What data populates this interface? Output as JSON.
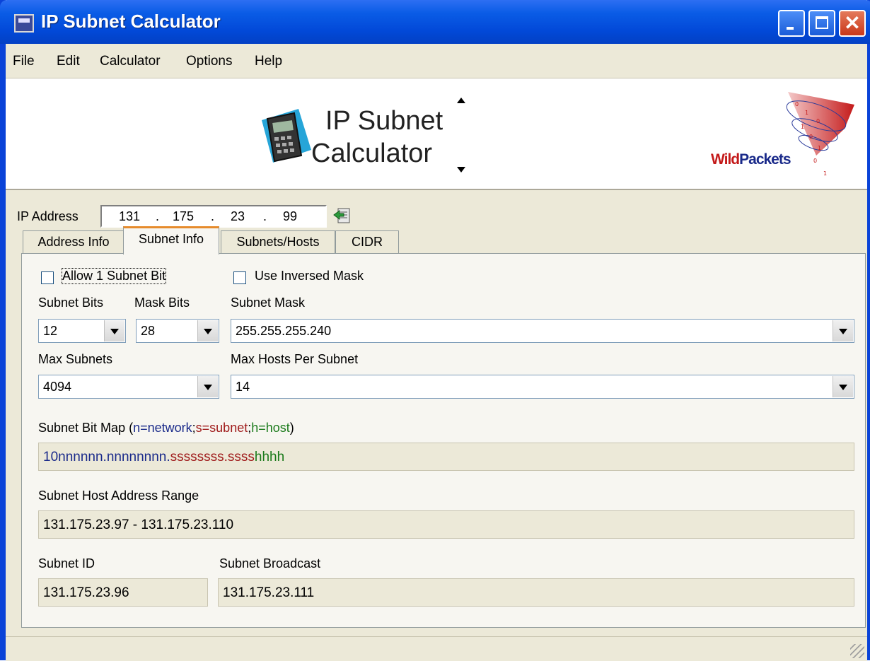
{
  "window": {
    "title": "IP Subnet Calculator"
  },
  "menu": {
    "items": [
      "File",
      "Edit",
      "Calculator",
      "Options",
      "Help"
    ]
  },
  "banner": {
    "line1": "IP Subnet",
    "line2": "Calculator",
    "brand_wild": "Wild",
    "brand_packets": "Packets"
  },
  "ip": {
    "label": "IP Address",
    "octets": [
      "131",
      "175",
      "23",
      "99"
    ]
  },
  "tabs": [
    "Address Info",
    "Subnet Info",
    "Subnets/Hosts",
    "CIDR"
  ],
  "active_tab": "Subnet Info",
  "form": {
    "allow_subnet_bit": "Allow 1 Subnet Bit",
    "use_inversed_mask": "Use Inversed Mask",
    "subnet_bits_label": "Subnet Bits",
    "subnet_bits_value": "12",
    "mask_bits_label": "Mask Bits",
    "mask_bits_value": "28",
    "subnet_mask_label": "Subnet Mask",
    "subnet_mask_value": "255.255.255.240",
    "max_subnets_label": "Max Subnets",
    "max_subnets_value": "4094",
    "max_hosts_label": "Max Hosts Per Subnet",
    "max_hosts_value": "14",
    "bitmap_label_prefix": "Subnet Bit Map (",
    "bitmap_label_n": "n=network",
    "bitmap_label_sep1": ";",
    "bitmap_label_s": "s=subnet",
    "bitmap_label_sep2": ";",
    "bitmap_label_h": "h=host",
    "bitmap_label_suffix": ")",
    "bitmap_network": "10nnnnnn.nnnnnnnn.",
    "bitmap_subnet": "ssssssss.ssss",
    "bitmap_host": "hhhh",
    "host_range_label": "Subnet Host Address Range",
    "host_range_value": "131.175.23.97 - 131.175.23.110",
    "subnet_id_label": "Subnet ID",
    "subnet_id_value": "131.175.23.96",
    "broadcast_label": "Subnet Broadcast",
    "broadcast_value": "131.175.23.111"
  },
  "colors": {
    "network": "#1a2a8a",
    "subnet": "#a01c1c",
    "host": "#1a7a1a",
    "titlebar": "#0a5ce6"
  }
}
